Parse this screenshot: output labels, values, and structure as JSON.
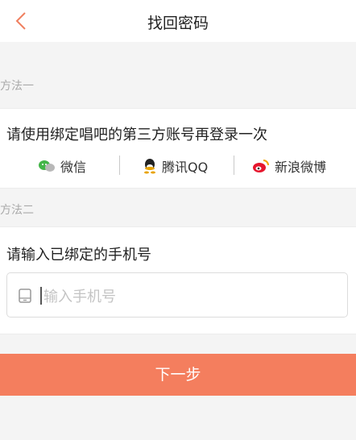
{
  "header": {
    "title": "找回密码",
    "back_icon": "chevron-left-icon",
    "accent_color": "#f08060"
  },
  "method1": {
    "label": "方法一",
    "instruction": "请使用绑定唱吧的第三方账号再登录一次",
    "options": [
      {
        "label": "微信",
        "icon": "wechat-icon",
        "color": "#44b549"
      },
      {
        "label": "腾讯QQ",
        "icon": "qq-icon",
        "color": "#222222"
      },
      {
        "label": "新浪微博",
        "icon": "weibo-icon",
        "color": "#e6162d"
      }
    ]
  },
  "method2": {
    "label": "方法二",
    "instruction": "请输入已绑定的手机号",
    "phone_input": {
      "placeholder": "输入手机号",
      "value": "",
      "icon": "phone-icon"
    }
  },
  "next_button": {
    "label": "下一步",
    "color": "#f47e5e"
  }
}
